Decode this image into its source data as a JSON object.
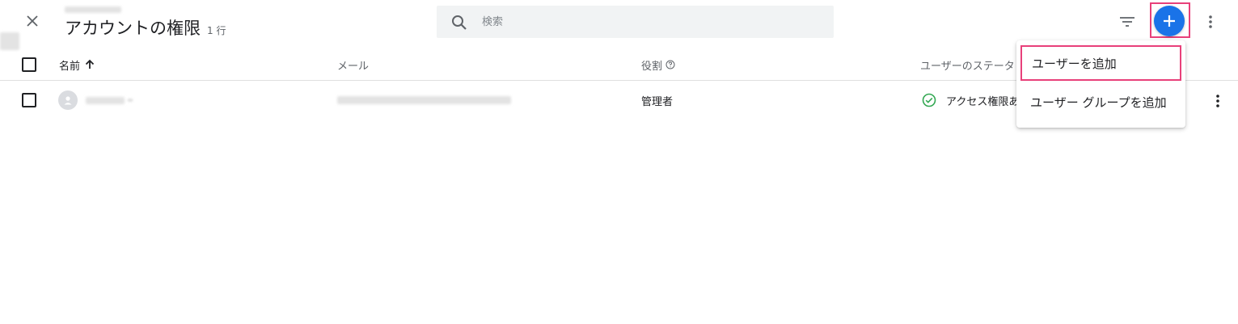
{
  "header": {
    "title": "アカウントの権限",
    "row_count": "1 行",
    "search_placeholder": "検索"
  },
  "table": {
    "columns": {
      "name": "名前",
      "email": "メール",
      "role": "役割",
      "status": "ユーザーのステータ"
    },
    "rows": [
      {
        "role": "管理者",
        "status": "アクセス権限あ"
      }
    ]
  },
  "add_menu": {
    "items": [
      "ユーザーを追加",
      "ユーザー グループを追加"
    ]
  },
  "colors": {
    "accent": "#1a73e8",
    "highlight": "#e8407a",
    "status_ok": "#34a853"
  }
}
